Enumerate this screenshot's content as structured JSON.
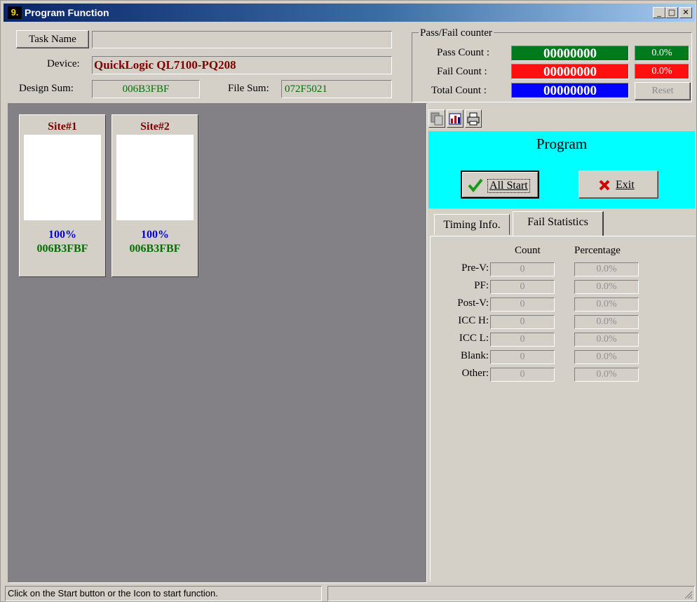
{
  "window": {
    "title": "Program Function",
    "app_icon": "9."
  },
  "header": {
    "task_name_button": "Task Name",
    "task_name_value": "",
    "device_label": "Device:",
    "device_value": "QuickLogic QL7100-PQ208",
    "design_sum_label": "Design Sum:",
    "design_sum_value": "006B3FBF",
    "file_sum_label": "File Sum:",
    "file_sum_value": "072F5021"
  },
  "counter": {
    "group_label": "Pass/Fail counter",
    "pass_label": "Pass Count :",
    "pass_value": "00000000",
    "pass_pct": "0.0%",
    "fail_label": "Fail Count :",
    "fail_value": "00000000",
    "fail_pct": "0.0%",
    "total_label": "Total Count :",
    "total_value": "00000000",
    "reset_label": "Reset",
    "colors": {
      "pass": "#007a1a",
      "fail": "#ff1010",
      "total": "#0000ff"
    }
  },
  "sites": [
    {
      "title": "Site#1",
      "percent": "100%",
      "sum": "006B3FBF"
    },
    {
      "title": "Site#2",
      "percent": "100%",
      "sum": "006B3FBF"
    }
  ],
  "toolbar": {
    "icons": [
      "copy-icon",
      "chart-icon",
      "printer-icon"
    ]
  },
  "program_panel": {
    "title": "Program",
    "all_start_label": "All Start",
    "exit_label": "Exit",
    "accent": "#00ffff"
  },
  "tabs": [
    {
      "label": "Timing Info.",
      "active": false
    },
    {
      "label": "Fail Statistics",
      "active": true
    }
  ],
  "fail_stats": {
    "count_header": "Count",
    "percentage_header": "Percentage",
    "rows": [
      {
        "label": "Pre-V:",
        "count": "0",
        "percentage": "0.0%"
      },
      {
        "label": "PF:",
        "count": "0",
        "percentage": "0.0%"
      },
      {
        "label": "Post-V:",
        "count": "0",
        "percentage": "0.0%"
      },
      {
        "label": "ICC H:",
        "count": "0",
        "percentage": "0.0%"
      },
      {
        "label": "ICC L:",
        "count": "0",
        "percentage": "0.0%"
      },
      {
        "label": "Blank:",
        "count": "0",
        "percentage": "0.0%"
      },
      {
        "label": "Other:",
        "count": "0",
        "percentage": "0.0%"
      }
    ]
  },
  "status_bar": {
    "message": "Click on the Start button or the Icon to start function."
  }
}
